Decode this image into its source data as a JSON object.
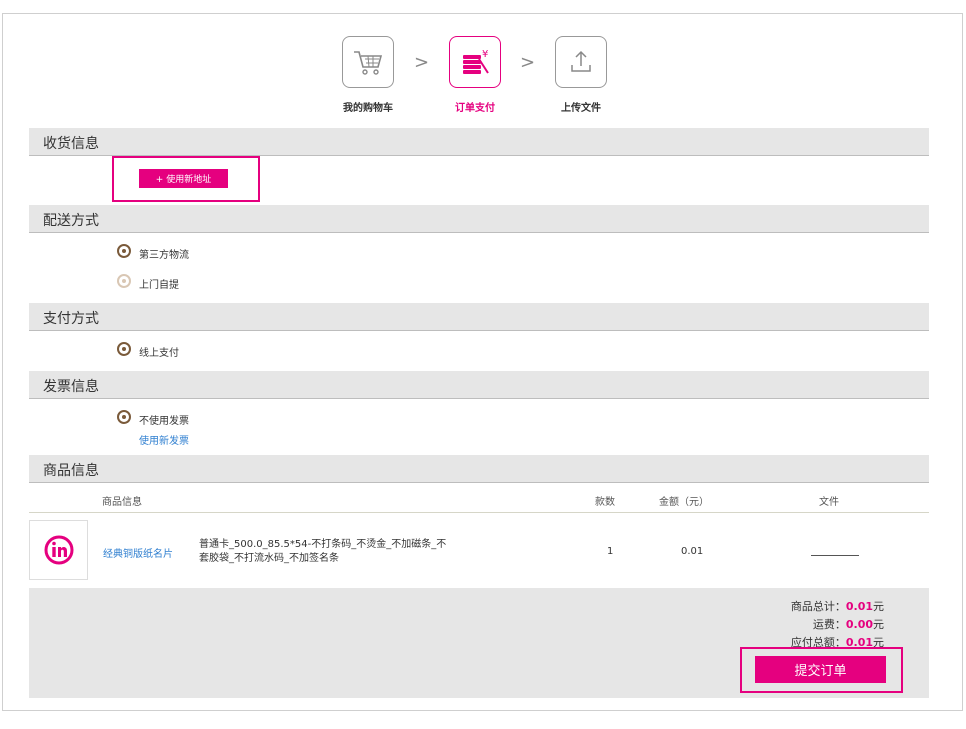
{
  "steps": [
    {
      "label": "我的购物车",
      "icon": "cart-icon",
      "active": false
    },
    {
      "label": "订单支付",
      "icon": "coins-yen-icon",
      "active": true
    },
    {
      "label": "上传文件",
      "icon": "upload-icon",
      "active": false
    }
  ],
  "step_separator": ">",
  "sections": {
    "shipping": {
      "title": "收货信息",
      "new_address_button": "+ 使用新地址"
    },
    "delivery": {
      "title": "配送方式",
      "options": [
        {
          "label": "第三方物流",
          "selected": true
        },
        {
          "label": "上门自提",
          "selected": false
        }
      ]
    },
    "payment": {
      "title": "支付方式",
      "options": [
        {
          "label": "线上支付",
          "selected": true
        }
      ]
    },
    "invoice": {
      "title": "发票信息",
      "options": [
        {
          "label": "不使用发票",
          "selected": true
        }
      ],
      "new_invoice_link": "使用新发票"
    },
    "products": {
      "title": "商品信息",
      "headers": {
        "info": "商品信息",
        "qty": "款数",
        "amount": "金额（元）",
        "file": "文件"
      },
      "items": [
        {
          "name": "经典铜版纸名片",
          "spec": "普通卡_500.0_85.5*54-不打条码_不烫金_不加磁条_不套胶袋_不打流水码_不加签名条",
          "qty": "1",
          "amount": "0.01",
          "thumb_icon": "in-logo-icon"
        }
      ]
    }
  },
  "summary": {
    "goods_total_label": "商品总计：",
    "goods_total_value": "0.01",
    "shipping_label": "运费：",
    "shipping_value": "0.00",
    "payable_label": "应付总额：",
    "payable_value": "0.01",
    "currency": "元",
    "submit_button": "提交订单"
  },
  "colors": {
    "accent": "#e5007f",
    "section_bg": "#e6e6e6",
    "link": "#2f7fd0",
    "radio": "#7a5a3a"
  }
}
